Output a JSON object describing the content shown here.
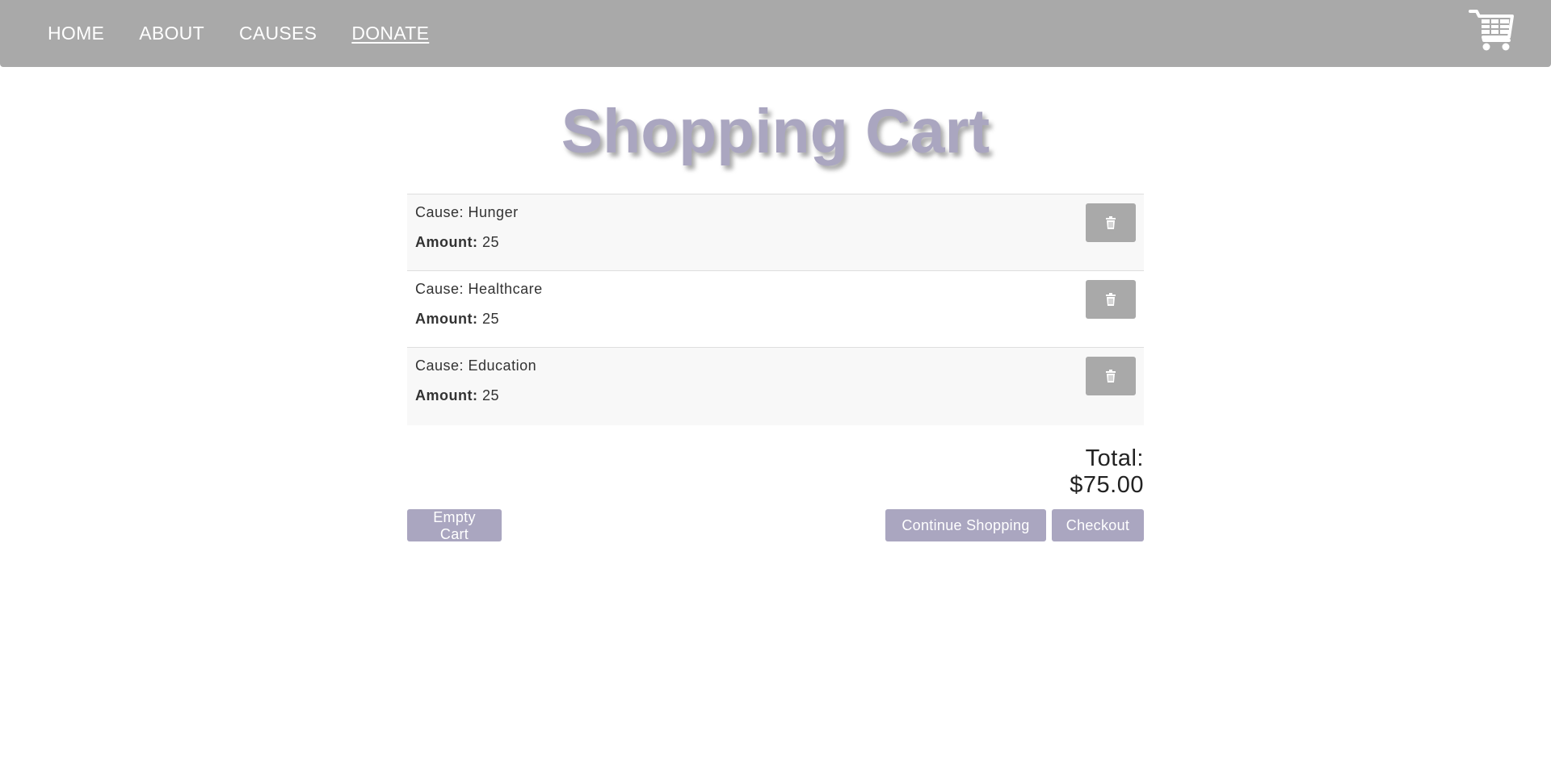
{
  "nav": {
    "items": [
      {
        "label": "HOME",
        "active": false
      },
      {
        "label": "ABOUT",
        "active": false
      },
      {
        "label": "CAUSES",
        "active": false
      },
      {
        "label": "DONATE",
        "active": true
      }
    ],
    "cart_icon": "cart-icon"
  },
  "page": {
    "title": "Shopping Cart"
  },
  "cart": {
    "cause_prefix": "Cause: ",
    "amount_label": "Amount:",
    "items": [
      {
        "cause": "Cause: Hunger",
        "amount": "25",
        "delete_icon": "trash-icon"
      },
      {
        "cause": "Cause: Healthcare",
        "amount": "25",
        "delete_icon": "trash-icon"
      },
      {
        "cause": "Cause: Education",
        "amount": "25",
        "delete_icon": "trash-icon"
      }
    ],
    "total_label": "Total:",
    "total_value": "$75.00"
  },
  "actions": {
    "empty_label": "Empty Cart",
    "continue_label": "Continue Shopping",
    "checkout_label": "Checkout"
  },
  "colors": {
    "navbar": "#a9a9a9",
    "accent": "#aaa6c0",
    "delete_button": "#a9a9a9"
  }
}
